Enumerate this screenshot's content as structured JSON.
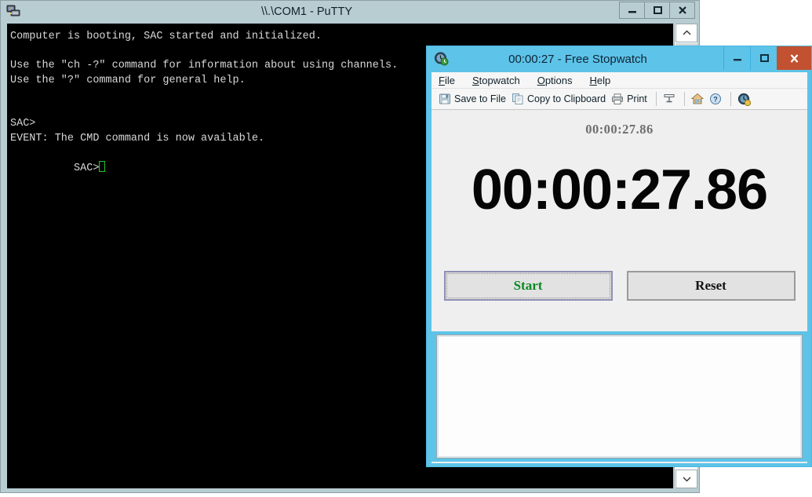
{
  "desktop": {
    "background_color": "#ffffff"
  },
  "putty": {
    "title": "\\\\.\\COM1 - PuTTY",
    "icon": "putty-computer-icon",
    "titlebar_color": "#b8cdd2",
    "terminal_background": "#000000",
    "terminal_foreground": "#d8d8d8",
    "window_buttons": [
      {
        "name": "minimize-button",
        "glyph": "minimize"
      },
      {
        "name": "maximize-button",
        "glyph": "maximize"
      },
      {
        "name": "close-button",
        "glyph": "close"
      }
    ],
    "terminal_lines": [
      "Computer is booting, SAC started and initialized.",
      "",
      "Use the \"ch -?\" command for information about using channels.",
      "Use the \"?\" command for general help.",
      "",
      "",
      "SAC>",
      "EVENT: The CMD command is now available."
    ],
    "prompt": "SAC>",
    "cursor_color": "#25c425",
    "scrollbar": {
      "up_arrow": "scroll-up-arrow",
      "down_arrow": "scroll-down-arrow"
    }
  },
  "stopwatch": {
    "title": "00:00:27 - Free Stopwatch",
    "icon": "stopwatch-clock-icon",
    "titlebar_color": "#5dc3e8",
    "close_button_color": "#c25131",
    "window_buttons": [
      {
        "name": "minimize-button",
        "glyph": "minimize"
      },
      {
        "name": "maximize-button",
        "glyph": "maximize"
      },
      {
        "name": "close-button",
        "glyph": "close"
      }
    ],
    "menu": [
      {
        "label": "File",
        "accel": "F"
      },
      {
        "label": "Stopwatch",
        "accel": "S"
      },
      {
        "label": "Options",
        "accel": "O"
      },
      {
        "label": "Help",
        "accel": "H"
      }
    ],
    "toolbar": {
      "save_to_file": "Save to File",
      "copy_to_clipboard": "Copy to Clipboard",
      "print": "Print",
      "icons": {
        "save": "floppy-disk-icon",
        "copy": "copy-pages-icon",
        "print": "printer-icon",
        "display": "display-settings-icon",
        "home": "home-icon",
        "about": "question-mark-icon",
        "clock": "world-clock-icon"
      }
    },
    "time_small": "00:00:27.86",
    "time_large": "00:00:27.86",
    "buttons": {
      "start": "Start",
      "reset": "Reset",
      "start_color": "#0a8a23",
      "reset_color": "#121212"
    },
    "laps": {
      "items": [],
      "background": "#fdfdfd"
    }
  }
}
